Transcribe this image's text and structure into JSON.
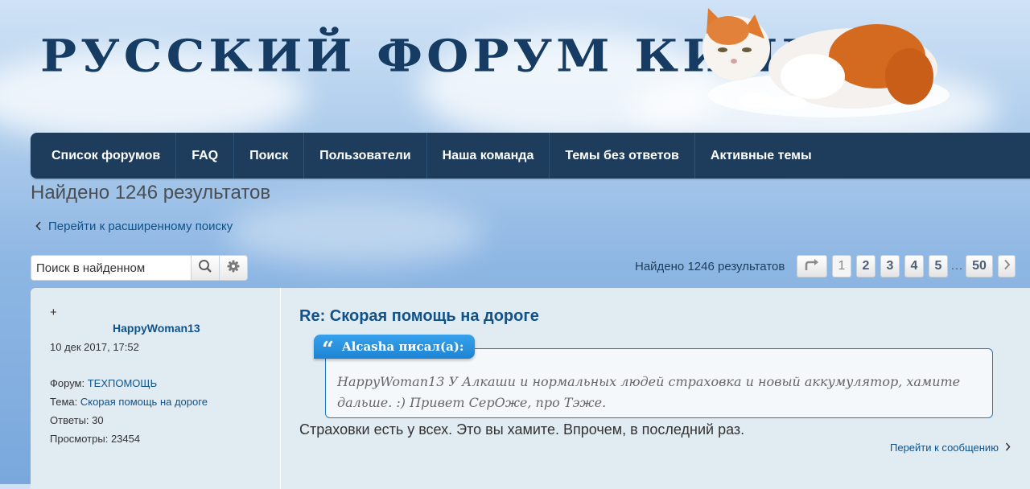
{
  "header": {
    "title": "Русский форум Кипра"
  },
  "nav": {
    "items": [
      "Список форумов",
      "FAQ",
      "Поиск",
      "Пользователи",
      "Наша команда",
      "Темы без ответов",
      "Активные темы"
    ]
  },
  "results": {
    "heading": "Найдено 1246 результатов",
    "advanced_link": "Перейти к расширенному поиску",
    "search_placeholder": "Поиск в найденном",
    "count_text": "Найдено 1246 результатов"
  },
  "pagination": {
    "pages": [
      "1",
      "2",
      "3",
      "4",
      "5"
    ],
    "ellipsis": "…",
    "last": "50",
    "current": "1"
  },
  "post": {
    "plus": "+",
    "author": "HappyWoman13",
    "date": "10 дек 2017, 17:52",
    "forum_label": "Форум:",
    "forum_value": "ТЕХПОМОЩЬ",
    "topic_label": "Тема:",
    "topic_value": "Скорая помощь на дороге",
    "replies_label": "Ответы:",
    "replies_value": "30",
    "views_label": "Просмотры:",
    "views_value": "23454",
    "title": "Re: Скорая помощь на дороге",
    "quote_author": "Alcasha писал(а):",
    "quote_text": "HappyWoman13 У Алкаши и нормальных людей страховка и новый аккумулятор, хамите дальше. :) Привет СерОже, про Тэже.",
    "body": "Страховки есть у всех. Это вы хамите. Впрочем, в последний раз.",
    "goto": "Перейти к сообщению"
  },
  "colors": {
    "navbar": "#1e3d5c",
    "link": "#105289",
    "panel": "#e1ebf2",
    "quote_accent": "#1f7bc4"
  },
  "icons": [
    "cat-image",
    "search-icon",
    "gear-icon",
    "jump-to-page-icon",
    "chevron-left-icon",
    "chevron-right-icon",
    "quote-icon"
  ]
}
